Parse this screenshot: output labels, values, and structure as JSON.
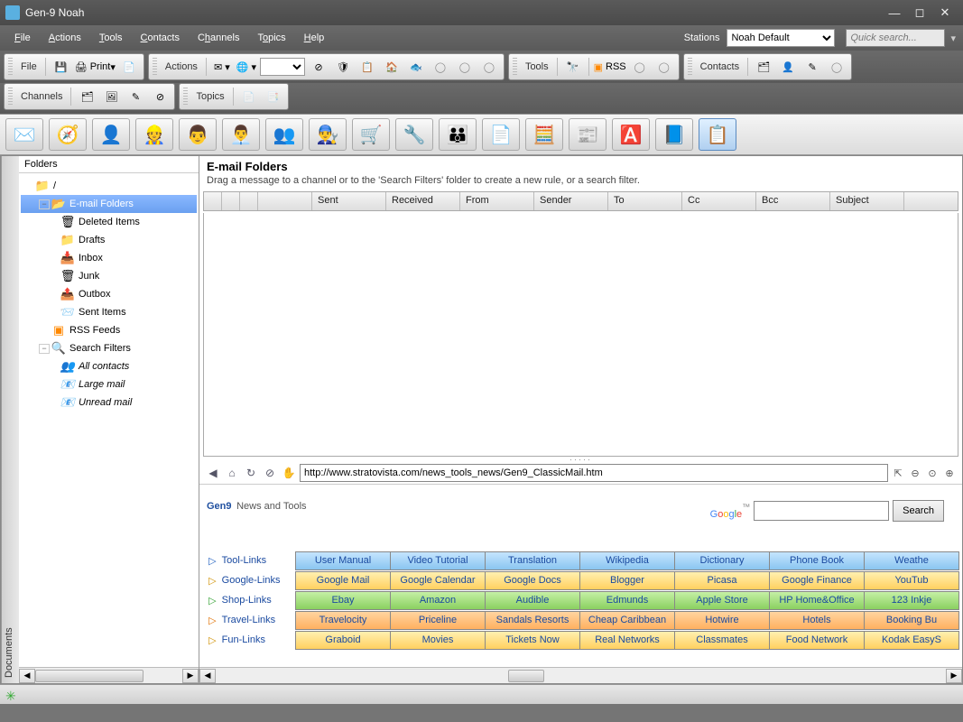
{
  "app": {
    "title": "Gen-9 Noah"
  },
  "menus": {
    "file": "File",
    "actions": "Actions",
    "tools": "Tools",
    "contacts": "Contacts",
    "channels": "Channels",
    "topics": "Topics",
    "help": "Help",
    "stations_label": "Stations",
    "station_selected": "Noah Default",
    "quick_search_placeholder": "Quick search..."
  },
  "toolbar1": {
    "file": "File",
    "print": "Print",
    "actions": "Actions",
    "tools": "Tools",
    "rss": "RSS",
    "contacts": "Contacts"
  },
  "toolbar2": {
    "channels": "Channels",
    "topics": "Topics"
  },
  "folders": {
    "header": "Folders",
    "root": "/",
    "email_folders": "E-mail Folders",
    "deleted": "Deleted Items",
    "drafts": "Drafts",
    "inbox": "Inbox",
    "junk": "Junk",
    "outbox": "Outbox",
    "sent": "Sent Items",
    "rss": "RSS Feeds",
    "search_filters": "Search Filters",
    "all_contacts": "All contacts",
    "large_mail": "Large mail",
    "unread_mail": "Unread mail"
  },
  "content": {
    "title": "E-mail Folders",
    "hint": "Drag a message to a channel or to the 'Search Filters' folder to create a new rule, or a search filter.",
    "columns": {
      "sent": "Sent",
      "received": "Received",
      "from": "From",
      "sender": "Sender",
      "to": "To",
      "cc": "Cc",
      "bcc": "Bcc",
      "subject": "Subject"
    }
  },
  "browser": {
    "url": "http://www.stratovista.com/news_tools_news/Gen9_ClassicMail.htm",
    "title1": "Gen9",
    "title2": "News and Tools",
    "search_button": "Search",
    "rows": [
      {
        "label": "Tool-Links",
        "color": "blue",
        "arrow": "#2060c0",
        "cells": [
          "User Manual",
          "Video Tutorial",
          "Translation",
          "Wikipedia",
          "Dictionary",
          "Phone Book",
          "Weathe"
        ]
      },
      {
        "label": "Google-Links",
        "color": "yellow",
        "arrow": "#d09000",
        "cells": [
          "Google Mail",
          "Google Calendar",
          "Google Docs",
          "Blogger",
          "Picasa",
          "Google Finance",
          "YouTub"
        ]
      },
      {
        "label": "Shop-Links",
        "color": "green",
        "arrow": "#30a030",
        "cells": [
          "Ebay",
          "Amazon",
          "Audible",
          "Edmunds",
          "Apple Store",
          "HP Home&Office",
          "123 Inkje"
        ]
      },
      {
        "label": "Travel-Links",
        "color": "orange",
        "arrow": "#e07000",
        "cells": [
          "Travelocity",
          "Priceline",
          "Sandals Resorts",
          "Cheap Caribbean",
          "Hotwire",
          "Hotels",
          "Booking Bu"
        ]
      },
      {
        "label": "Fun-Links",
        "color": "yellow",
        "arrow": "#d09000",
        "cells": [
          "Graboid",
          "Movies",
          "Tickets Now",
          "Real Networks",
          "Classmates",
          "Food Network",
          "Kodak EasyS"
        ]
      }
    ]
  }
}
